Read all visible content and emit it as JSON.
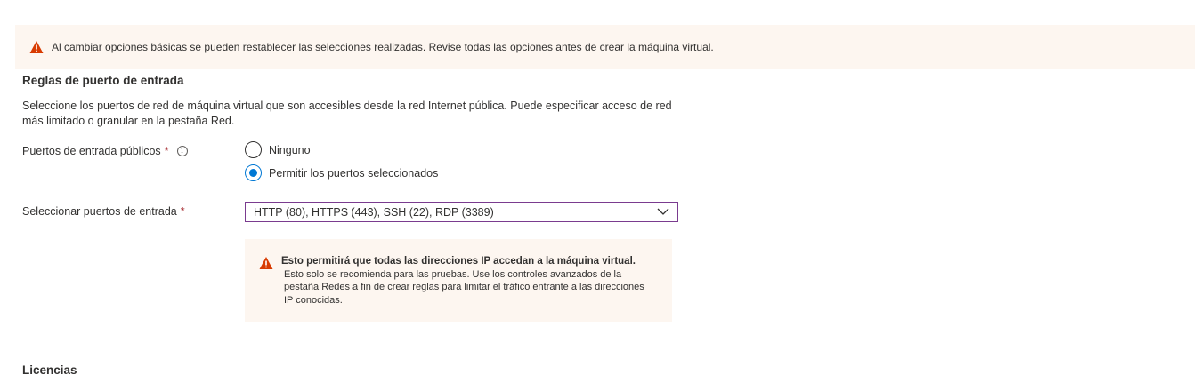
{
  "banner": {
    "icon": "warning-icon",
    "text": "Al cambiar opciones básicas se pueden restablecer las selecciones realizadas. Revise todas las opciones antes de crear la máquina virtual."
  },
  "inbound_rules": {
    "title": "Reglas de puerto de entrada",
    "description": "Seleccione los puertos de red de máquina virtual que son accesibles desde la red Internet pública. Puede especificar acceso de red más limitado o granular en la pestaña Red."
  },
  "public_ports": {
    "label": "Puertos de entrada públicos",
    "required_mark": "*",
    "info_glyph": "i",
    "options": [
      {
        "label": "Ninguno",
        "selected": false
      },
      {
        "label": "Permitir los puertos seleccionados",
        "selected": true
      }
    ]
  },
  "select_ports": {
    "label": "Seleccionar puertos de entrada",
    "required_mark": "*",
    "value": "HTTP (80), HTTPS (443), SSH (22), RDP (3389)"
  },
  "port_warning": {
    "icon": "warning-icon",
    "title": "Esto permitirá que todas las direcciones IP accedan a la máquina virtual.",
    "body": "Esto solo se recomienda para las pruebas.  Use los controles avanzados de la pestaña Redes a fin de crear reglas para limitar el tráfico entrante a las direcciones IP conocidas."
  },
  "licenses": {
    "title": "Licencias"
  },
  "colors": {
    "accent": "#0078d4",
    "warning": "#d83b01",
    "required": "#a4262c",
    "banner_bg": "#fdf6f0",
    "dropdown_border": "#7a3b8f"
  }
}
